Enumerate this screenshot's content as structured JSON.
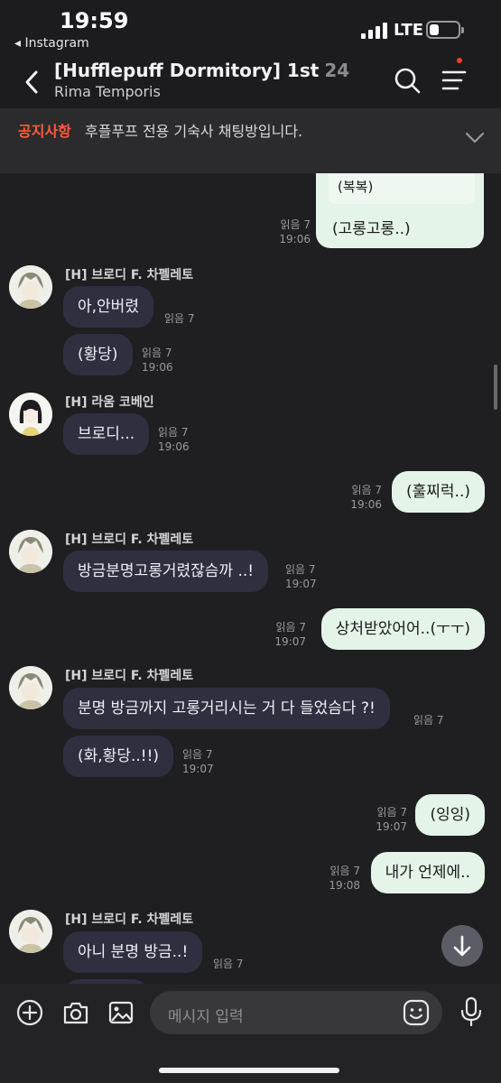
{
  "status": {
    "time": "19:59",
    "back_app": "◂ Instagram",
    "network": "LTE"
  },
  "header": {
    "title": "[Hufflepuff Dormitory] 1st",
    "member_count": "24",
    "subtitle": "Rima Temporis"
  },
  "notice": {
    "tag": "공지사항",
    "text": "후플푸프 전용 기숙사 채팅방입니다."
  },
  "messages": {
    "q_sub": "(복복)",
    "q_main": "(고롱고롱..)",
    "q_read": "읽음 7",
    "q_time": "19:06",
    "m1_sender": "[H] 브로디 F. 차펠레토",
    "m1_text": "아,안버렸",
    "m1_read": "읽음 7",
    "m2_text": "(황당)",
    "m2_read": "읽음 7",
    "m2_time": "19:06",
    "m3_sender": "[H] 라움 코베인",
    "m3_text": "브로디...",
    "m3_read": "읽음 7",
    "m3_time": "19:06",
    "m4_text": "(훌찌럭..)",
    "m4_read": "읽음 7",
    "m4_time": "19:06",
    "m5_sender": "[H] 브로디 F. 차펠레토",
    "m5_text": "방금분명고롱거렸잖슴까 ..!",
    "m5_read": "읽음 7",
    "m5_time": "19:07",
    "m6_text": "상처받았어어..(ㅜㅜ)",
    "m6_read": "읽음 7",
    "m6_time": "19:07",
    "m7_sender": "[H] 브로디 F. 차펠레토",
    "m7_text": "분명 방금까지 고롱거리시는 거 다 들었슴다 ?!",
    "m7_read": "읽음 7",
    "m8_text": "(화,황당..!!)",
    "m8_read": "읽음 7",
    "m8_time": "19:07",
    "m9_text": "(잉잉)",
    "m9_read": "읽음 7",
    "m9_time": "19:07",
    "m10_text": "내가 언제에..",
    "m10_read": "읽음 7",
    "m10_time": "19:08",
    "m11_sender": "[H] 브로디 F. 차펠레토",
    "m11_text": "아니 분명 방금..!",
    "m11_read": "읽음 7"
  },
  "composer": {
    "placeholder": "메시지 입력"
  },
  "colors": {
    "background": "#1f1f21",
    "incoming_bubble": "#2e3040",
    "outgoing_bubble": "#e4f4e8",
    "notice_tag": "#ff5a3c"
  },
  "icons": [
    "back-icon",
    "search-icon",
    "menu-icon",
    "chevron-down-icon",
    "arrow-down-icon",
    "plus-icon",
    "camera-icon",
    "image-icon",
    "emoji-icon",
    "mic-icon"
  ]
}
